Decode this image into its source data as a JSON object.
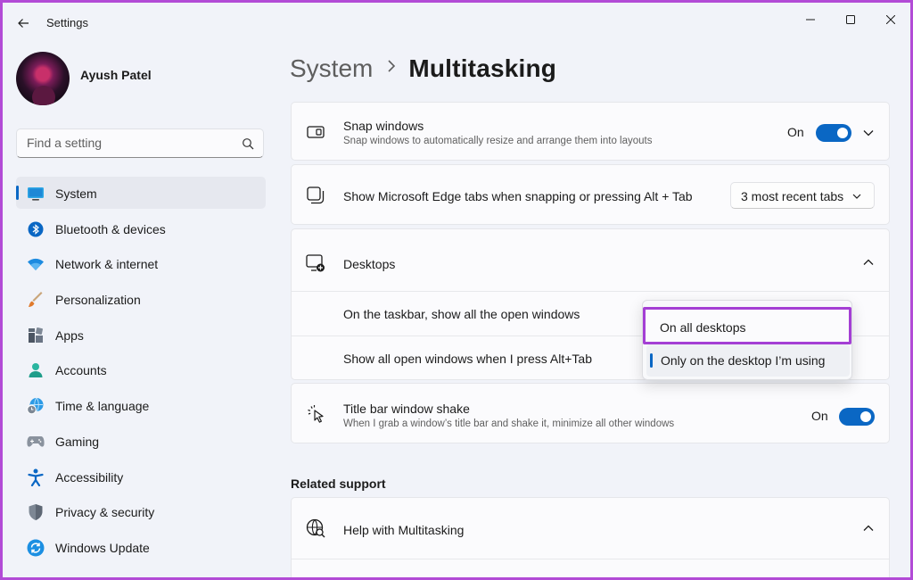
{
  "window": {
    "title": "Settings"
  },
  "profile": {
    "name": "Ayush Patel"
  },
  "search": {
    "placeholder": "Find a setting"
  },
  "nav": {
    "items": [
      {
        "label": "System",
        "icon": "monitor-icon"
      },
      {
        "label": "Bluetooth & devices",
        "icon": "bluetooth-icon"
      },
      {
        "label": "Network & internet",
        "icon": "wifi-icon"
      },
      {
        "label": "Personalization",
        "icon": "brush-icon"
      },
      {
        "label": "Apps",
        "icon": "apps-icon"
      },
      {
        "label": "Accounts",
        "icon": "person-icon"
      },
      {
        "label": "Time & language",
        "icon": "globe-clock-icon"
      },
      {
        "label": "Gaming",
        "icon": "gamepad-icon"
      },
      {
        "label": "Accessibility",
        "icon": "accessibility-icon"
      },
      {
        "label": "Privacy & security",
        "icon": "shield-icon"
      },
      {
        "label": "Windows Update",
        "icon": "sync-icon"
      }
    ],
    "active_index": 0
  },
  "breadcrumb": {
    "parent": "System",
    "current": "Multitasking"
  },
  "snap_windows": {
    "title": "Snap windows",
    "description": "Snap windows to automatically resize and arrange them into layouts",
    "state_label": "On"
  },
  "edge_tabs": {
    "title": "Show Microsoft Edge tabs when snapping or pressing Alt + Tab",
    "selected": "3 most recent tabs"
  },
  "desktops": {
    "title": "Desktops",
    "taskbar_row": "On the taskbar, show all the open windows",
    "alttab_row": "Show all open windows when I press Alt+Tab",
    "menu_options": [
      "On all desktops",
      "Only on the desktop I’m using"
    ]
  },
  "title_bar_shake": {
    "title": "Title bar window shake",
    "description": "When I grab a window’s title bar and shake it, minimize all other windows",
    "state_label": "On"
  },
  "related_support": {
    "heading": "Related support",
    "help_title": "Help with Multitasking"
  },
  "colors": {
    "accent": "#0a67c4",
    "highlight": "#a43fd4"
  }
}
